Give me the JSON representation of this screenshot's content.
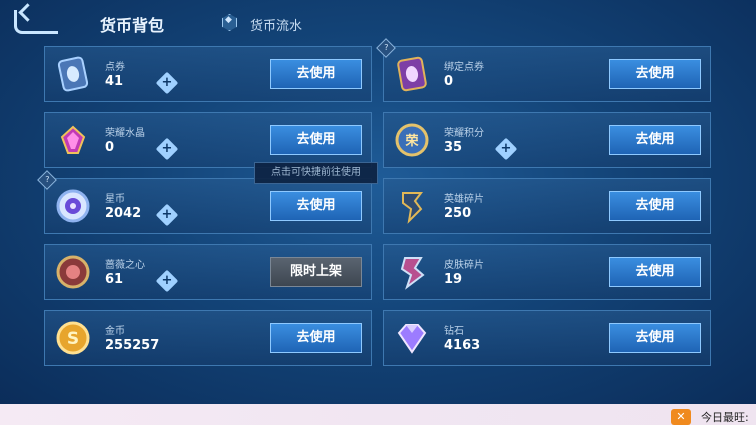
{
  "header": {
    "tab_active": "货币背包",
    "tab_other": "货币流水"
  },
  "tooltip": "点击可快捷前往使用",
  "items": [
    {
      "name": "点券",
      "value": "41",
      "button": "去使用",
      "plus": "+",
      "icon": "ticket-icon"
    },
    {
      "name": "绑定点券",
      "value": "0",
      "button": "去使用",
      "icon": "bound-ticket-icon",
      "help": "?"
    },
    {
      "name": "荣耀水晶",
      "value": "0",
      "button": "去使用",
      "plus": "+",
      "icon": "glory-crystal-icon"
    },
    {
      "name": "荣耀积分",
      "value": "35",
      "button": "去使用",
      "plus": "+",
      "icon": "glory-points-icon",
      "icon_text": "荣"
    },
    {
      "name": "星币",
      "value": "2042",
      "button": "去使用",
      "plus": "+",
      "icon": "star-coin-icon",
      "help": "?"
    },
    {
      "name": "英雄碎片",
      "value": "250",
      "button": "去使用",
      "icon": "hero-shard-icon"
    },
    {
      "name": "蔷薇之心",
      "value": "61",
      "button": "限时上架",
      "plus": "+",
      "icon": "rose-heart-icon"
    },
    {
      "name": "皮肤碎片",
      "value": "19",
      "button": "去使用",
      "icon": "skin-shard-icon"
    },
    {
      "name": "金币",
      "value": "255257",
      "button": "去使用",
      "icon": "gold-coin-icon",
      "icon_text": "S"
    },
    {
      "name": "钻石",
      "value": "4163",
      "button": "去使用",
      "icon": "diamond-icon"
    }
  ],
  "bottom": {
    "icon_text": "✕",
    "text": "今日最旺:"
  }
}
